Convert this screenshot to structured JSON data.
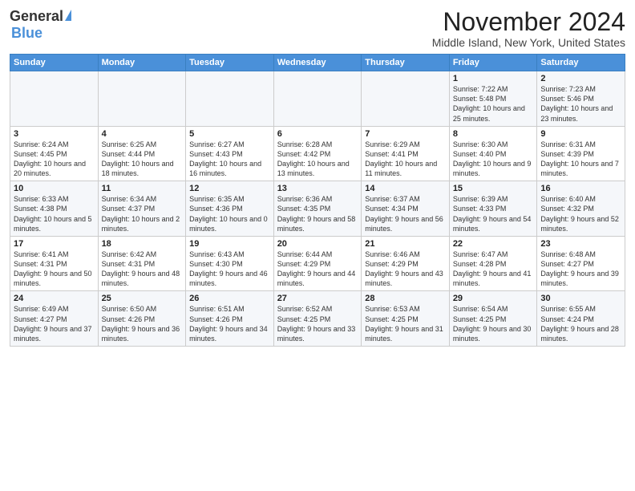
{
  "logo": {
    "general": "General",
    "blue": "Blue"
  },
  "header": {
    "month": "November 2024",
    "location": "Middle Island, New York, United States"
  },
  "weekdays": [
    "Sunday",
    "Monday",
    "Tuesday",
    "Wednesday",
    "Thursday",
    "Friday",
    "Saturday"
  ],
  "weeks": [
    [
      {
        "day": "",
        "info": ""
      },
      {
        "day": "",
        "info": ""
      },
      {
        "day": "",
        "info": ""
      },
      {
        "day": "",
        "info": ""
      },
      {
        "day": "",
        "info": ""
      },
      {
        "day": "1",
        "info": "Sunrise: 7:22 AM\nSunset: 5:48 PM\nDaylight: 10 hours and 25 minutes."
      },
      {
        "day": "2",
        "info": "Sunrise: 7:23 AM\nSunset: 5:46 PM\nDaylight: 10 hours and 23 minutes."
      }
    ],
    [
      {
        "day": "3",
        "info": "Sunrise: 6:24 AM\nSunset: 4:45 PM\nDaylight: 10 hours and 20 minutes."
      },
      {
        "day": "4",
        "info": "Sunrise: 6:25 AM\nSunset: 4:44 PM\nDaylight: 10 hours and 18 minutes."
      },
      {
        "day": "5",
        "info": "Sunrise: 6:27 AM\nSunset: 4:43 PM\nDaylight: 10 hours and 16 minutes."
      },
      {
        "day": "6",
        "info": "Sunrise: 6:28 AM\nSunset: 4:42 PM\nDaylight: 10 hours and 13 minutes."
      },
      {
        "day": "7",
        "info": "Sunrise: 6:29 AM\nSunset: 4:41 PM\nDaylight: 10 hours and 11 minutes."
      },
      {
        "day": "8",
        "info": "Sunrise: 6:30 AM\nSunset: 4:40 PM\nDaylight: 10 hours and 9 minutes."
      },
      {
        "day": "9",
        "info": "Sunrise: 6:31 AM\nSunset: 4:39 PM\nDaylight: 10 hours and 7 minutes."
      }
    ],
    [
      {
        "day": "10",
        "info": "Sunrise: 6:33 AM\nSunset: 4:38 PM\nDaylight: 10 hours and 5 minutes."
      },
      {
        "day": "11",
        "info": "Sunrise: 6:34 AM\nSunset: 4:37 PM\nDaylight: 10 hours and 2 minutes."
      },
      {
        "day": "12",
        "info": "Sunrise: 6:35 AM\nSunset: 4:36 PM\nDaylight: 10 hours and 0 minutes."
      },
      {
        "day": "13",
        "info": "Sunrise: 6:36 AM\nSunset: 4:35 PM\nDaylight: 9 hours and 58 minutes."
      },
      {
        "day": "14",
        "info": "Sunrise: 6:37 AM\nSunset: 4:34 PM\nDaylight: 9 hours and 56 minutes."
      },
      {
        "day": "15",
        "info": "Sunrise: 6:39 AM\nSunset: 4:33 PM\nDaylight: 9 hours and 54 minutes."
      },
      {
        "day": "16",
        "info": "Sunrise: 6:40 AM\nSunset: 4:32 PM\nDaylight: 9 hours and 52 minutes."
      }
    ],
    [
      {
        "day": "17",
        "info": "Sunrise: 6:41 AM\nSunset: 4:31 PM\nDaylight: 9 hours and 50 minutes."
      },
      {
        "day": "18",
        "info": "Sunrise: 6:42 AM\nSunset: 4:31 PM\nDaylight: 9 hours and 48 minutes."
      },
      {
        "day": "19",
        "info": "Sunrise: 6:43 AM\nSunset: 4:30 PM\nDaylight: 9 hours and 46 minutes."
      },
      {
        "day": "20",
        "info": "Sunrise: 6:44 AM\nSunset: 4:29 PM\nDaylight: 9 hours and 44 minutes."
      },
      {
        "day": "21",
        "info": "Sunrise: 6:46 AM\nSunset: 4:29 PM\nDaylight: 9 hours and 43 minutes."
      },
      {
        "day": "22",
        "info": "Sunrise: 6:47 AM\nSunset: 4:28 PM\nDaylight: 9 hours and 41 minutes."
      },
      {
        "day": "23",
        "info": "Sunrise: 6:48 AM\nSunset: 4:27 PM\nDaylight: 9 hours and 39 minutes."
      }
    ],
    [
      {
        "day": "24",
        "info": "Sunrise: 6:49 AM\nSunset: 4:27 PM\nDaylight: 9 hours and 37 minutes."
      },
      {
        "day": "25",
        "info": "Sunrise: 6:50 AM\nSunset: 4:26 PM\nDaylight: 9 hours and 36 minutes."
      },
      {
        "day": "26",
        "info": "Sunrise: 6:51 AM\nSunset: 4:26 PM\nDaylight: 9 hours and 34 minutes."
      },
      {
        "day": "27",
        "info": "Sunrise: 6:52 AM\nSunset: 4:25 PM\nDaylight: 9 hours and 33 minutes."
      },
      {
        "day": "28",
        "info": "Sunrise: 6:53 AM\nSunset: 4:25 PM\nDaylight: 9 hours and 31 minutes."
      },
      {
        "day": "29",
        "info": "Sunrise: 6:54 AM\nSunset: 4:25 PM\nDaylight: 9 hours and 30 minutes."
      },
      {
        "day": "30",
        "info": "Sunrise: 6:55 AM\nSunset: 4:24 PM\nDaylight: 9 hours and 28 minutes."
      }
    ]
  ]
}
